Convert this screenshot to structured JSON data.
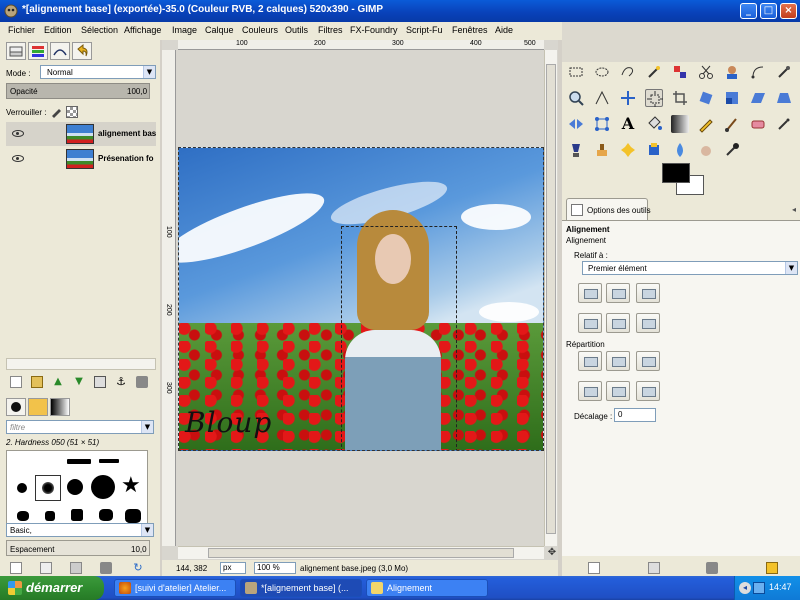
{
  "window": {
    "title": "*[alignement base] (exportée)-35.0 (Couleur RVB, 2 calques) 520x390 - GIMP",
    "minimize_label": "_",
    "maximize_label": "□",
    "close_label": "×"
  },
  "menu": [
    "Fichier",
    "Edition",
    "Sélection",
    "Affichage",
    "Image",
    "Calque",
    "Couleurs",
    "Outils",
    "Filtres",
    "FX-Foundry",
    "Script-Fu",
    "Fenêtres",
    "Aide"
  ],
  "layers_panel": {
    "mode_label": "Mode :",
    "mode_value": "Normal",
    "opacity_label": "Opacité",
    "opacity_value": "100,0",
    "lock_label": "Verrouiller :",
    "layers": [
      {
        "name": "alignement bas",
        "selected": true
      },
      {
        "name": "Présenation fo",
        "selected": false
      }
    ]
  },
  "brushes_panel": {
    "filter_placeholder": "filtre",
    "brush_name": "2. Hardness 050 (51 × 51)",
    "preset_label": "Basic,",
    "spacing_label": "Espacement",
    "spacing_value": "10,0"
  },
  "rulers": {
    "h_ticks": [
      "100",
      "200",
      "300",
      "400",
      "500"
    ],
    "v_ticks": [
      "100",
      "200",
      "300"
    ]
  },
  "canvas": {
    "logo_text": "Bloup",
    "colors": {
      "sky": "#3e7fd1",
      "poppy": "#d81919",
      "grass": "#3e7f25"
    }
  },
  "status": {
    "coords": "144, 382",
    "unit": "px",
    "zoom": "100 %",
    "file_info": "alignement base.jpeg (3,0 Mo)"
  },
  "tool_options": {
    "tab_label": "Options des outils",
    "section_title": "Alignement",
    "subtitle": "Alignement",
    "relative_label": "Relatif à :",
    "relative_value": "Premier élément",
    "distribution_label": "Répartition",
    "offset_label": "Décalage :",
    "offset_value": "0"
  },
  "taskbar": {
    "start_label": "démarrer",
    "items": [
      {
        "label": "[suivi d'atelier] Atelier...",
        "active": false
      },
      {
        "label": "*[alignement base] (...",
        "active": true
      },
      {
        "label": "Alignement",
        "active": false
      }
    ],
    "clock": "14:47"
  }
}
